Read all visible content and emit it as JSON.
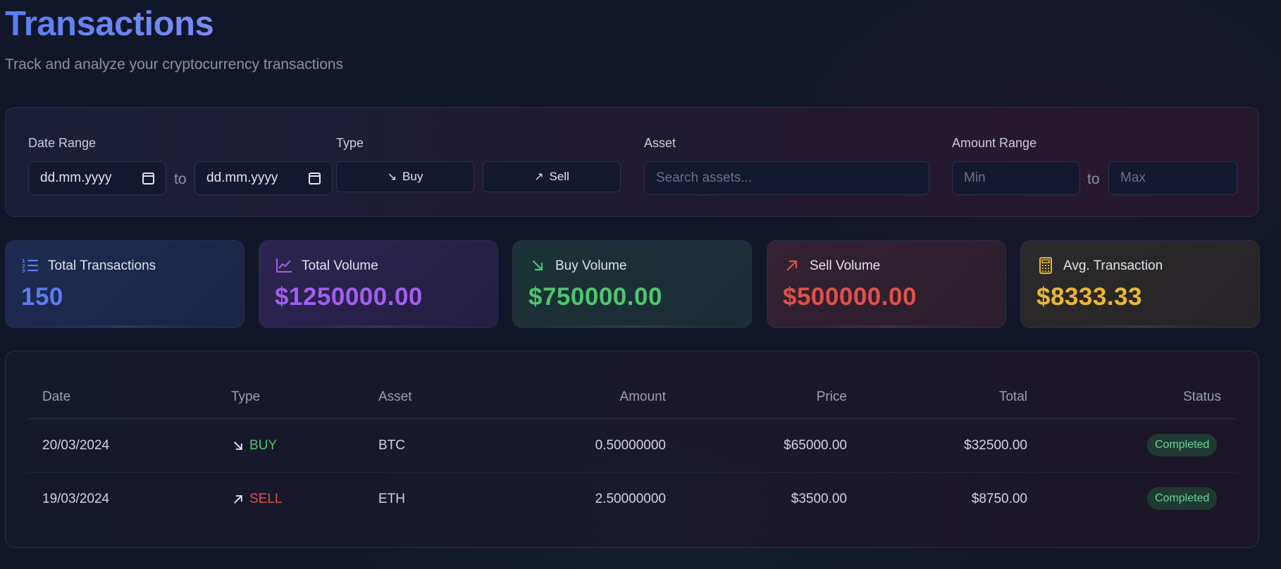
{
  "header": {
    "title": "Transactions",
    "subtitle": "Track and analyze your cryptocurrency transactions"
  },
  "filters": {
    "date_range_label": "Date Range",
    "date_from_placeholder": "dd.mm.yyyy",
    "date_to_placeholder": "dd.mm.yyyy",
    "to_text": "to",
    "type_label": "Type",
    "buy_label": "Buy",
    "sell_label": "Sell",
    "asset_label": "Asset",
    "asset_placeholder": "Search assets...",
    "amount_range_label": "Amount Range",
    "min_placeholder": "Min",
    "max_placeholder": "Max"
  },
  "stats": [
    {
      "label": "Total Transactions",
      "value": "150",
      "icon": "list-icon",
      "color": "#5b7df0"
    },
    {
      "label": "Total Volume",
      "value": "$1250000.00",
      "icon": "chart-line-icon",
      "color": "#a35ef0"
    },
    {
      "label": "Buy Volume",
      "value": "$750000.00",
      "icon": "arrow-down-right-icon",
      "color": "#4fc46f"
    },
    {
      "label": "Sell Volume",
      "value": "$500000.00",
      "icon": "arrow-up-right-icon",
      "color": "#e0504a"
    },
    {
      "label": "Avg. Transaction",
      "value": "$8333.33",
      "icon": "calculator-icon",
      "color": "#e8b735"
    }
  ],
  "table": {
    "columns": [
      "Date",
      "Type",
      "Asset",
      "Amount",
      "Price",
      "Total",
      "Status"
    ],
    "rows": [
      {
        "date": "20/03/2024",
        "type": "BUY",
        "asset": "BTC",
        "amount": "0.50000000",
        "price": "$65000.00",
        "total": "$32500.00",
        "status": "Completed"
      },
      {
        "date": "19/03/2024",
        "type": "SELL",
        "asset": "ETH",
        "amount": "2.50000000",
        "price": "$3500.00",
        "total": "$8750.00",
        "status": "Completed"
      }
    ]
  },
  "colors": {
    "accent": "#5b7df0",
    "buy": "#4fc46f",
    "sell": "#e0504a",
    "status_completed": "#6fd39a"
  }
}
